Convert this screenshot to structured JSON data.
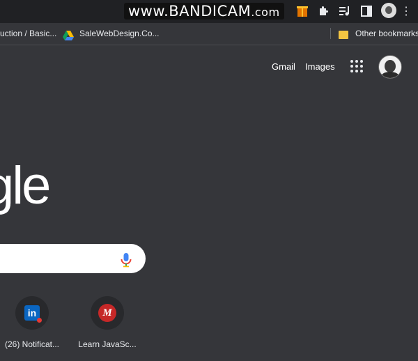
{
  "toolbar": {
    "watermark_main": "www.BANDICAM",
    "watermark_suffix": ".com",
    "icons": [
      "gift-icon",
      "puzzle-icon",
      "media-queue-icon",
      "side-panel-icon",
      "profile-avatar",
      "more-menu-icon"
    ]
  },
  "bookmarks": {
    "items": [
      {
        "label": "uction / Basic...",
        "icon": "none"
      },
      {
        "label": "SaleWebDesign.Co...",
        "icon": "google-drive-icon"
      }
    ],
    "other": {
      "label": "Other bookmarks",
      "icon": "folder-icon"
    }
  },
  "header": {
    "gmail": "Gmail",
    "images": "Images",
    "apps_icon": "apps-grid-icon"
  },
  "logo_text": "gle",
  "search": {
    "value": "",
    "mic_icon": "microphone-icon"
  },
  "shortcuts": [
    {
      "label": "(26) Notificat...",
      "icon": "linkedin-icon",
      "icon_text": "in",
      "accent": "#0a66c2"
    },
    {
      "label": "Learn JavaSc...",
      "icon": "m-logo-icon",
      "icon_text": "M",
      "accent": "#c62828"
    }
  ],
  "colors": {
    "background": "#35363a",
    "toolbar": "#202124",
    "text": "#e8eaed"
  }
}
